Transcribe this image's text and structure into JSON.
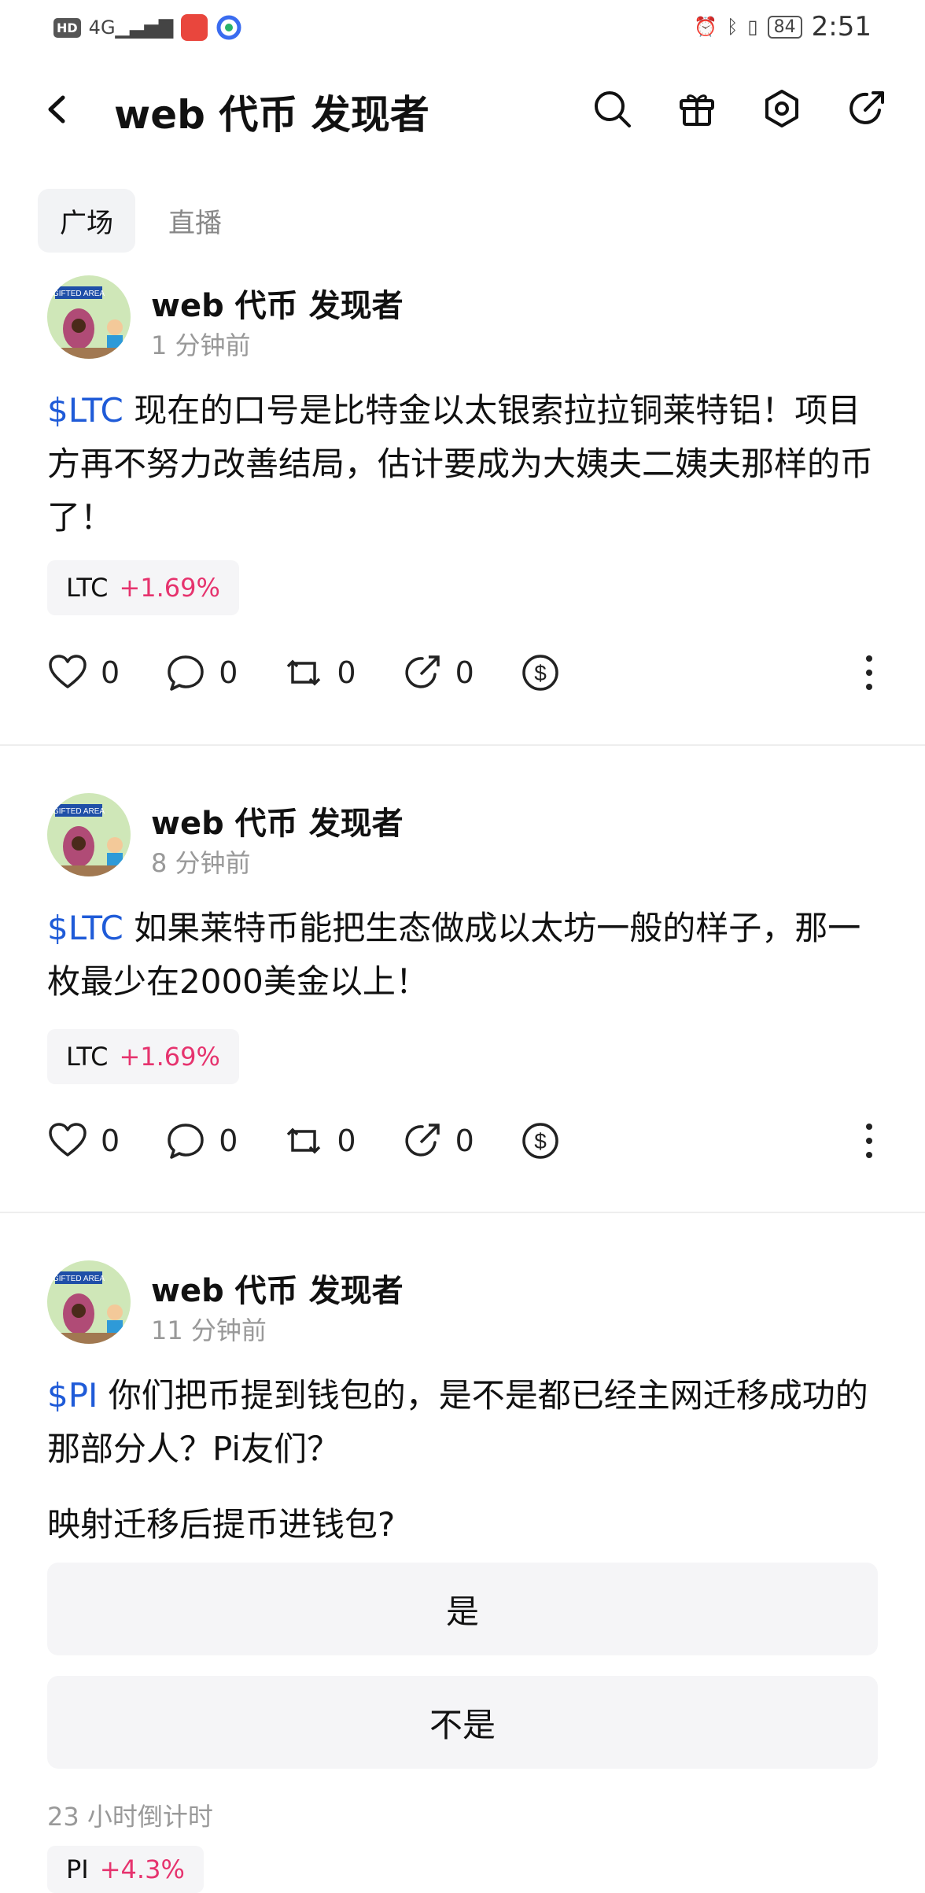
{
  "status_bar": {
    "hd": "HD",
    "network": "4G",
    "battery": "84",
    "time": "2:51"
  },
  "header": {
    "title": "web 代币 发现者"
  },
  "tabs": [
    {
      "label": "广场"
    },
    {
      "label": "直播"
    }
  ],
  "posts": [
    {
      "author": "web 代币 发现者",
      "time": "1 分钟前",
      "tag": "$LTC",
      "text": " 现在的口号是比特金以太银索拉拉铜莱特铝！项目方再不努力改善结局，估计要成为大姨夫二姨夫那样的币了！",
      "chip_symbol": "LTC",
      "chip_change": "+1.69%",
      "likes": "0",
      "comments": "0",
      "reposts": "0",
      "shares": "0"
    },
    {
      "author": "web 代币 发现者",
      "time": "8 分钟前",
      "tag": "$LTC",
      "text": " 如果莱特币能把生态做成以太坊一般的样子，那一枚最少在2000美金以上！",
      "chip_symbol": "LTC",
      "chip_change": "+1.69%",
      "likes": "0",
      "comments": "0",
      "reposts": "0",
      "shares": "0"
    },
    {
      "author": "web 代币 发现者",
      "time": "11 分钟前",
      "tag": "$PI",
      "text": " 你们把币提到钱包的，是不是都已经主网迁移成功的那部分人？Pi友们？",
      "poll_question": "映射迁移后提币进钱包?",
      "poll_options": [
        "是",
        "不是"
      ],
      "countdown": "23 小时倒计时",
      "chip_symbol": "PI",
      "chip_change": "+4.3%"
    }
  ],
  "colors": {
    "accent_link": "#1f5bd8",
    "positive_change": "#e6336e"
  }
}
